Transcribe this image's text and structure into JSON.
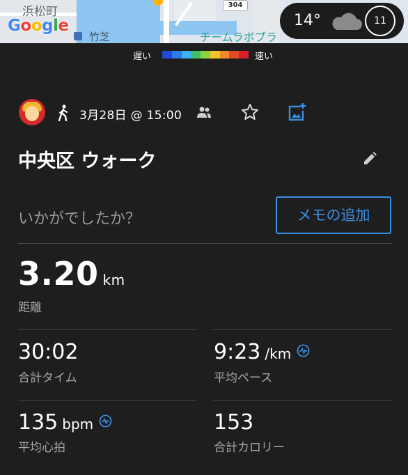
{
  "map": {
    "town_label": "浜松町",
    "station_label": "竹芝",
    "team_label": "チームラボプラ",
    "road_number": "304",
    "google_letters": [
      "G",
      "o",
      "o",
      "g",
      "l",
      "e"
    ]
  },
  "weather": {
    "temperature": "14°",
    "icon": "cloud-icon",
    "count": "11"
  },
  "speed_legend": {
    "slow_label": "遅い",
    "fast_label": "速い",
    "colors": [
      "#1f4bd6",
      "#2d7ae6",
      "#3fb0f0",
      "#3fbf6a",
      "#8fd13a",
      "#f2c12e",
      "#f08a2a",
      "#e24a2a",
      "#d81f2a"
    ]
  },
  "activity": {
    "type_icon": "walk-icon",
    "date": "3月28日 @ 15:00",
    "title": "中央区 ウォーク",
    "feeling_prompt": "いかがでしたか？",
    "add_memo_label": "メモの追加"
  },
  "stats": {
    "distance": {
      "value": "3.20",
      "unit": "km",
      "label": "距離"
    },
    "total_time": {
      "value": "30:02",
      "label": "合計タイム"
    },
    "avg_pace": {
      "value": "9:23",
      "unit": "/km",
      "label": "平均ペース"
    },
    "avg_heart_rate": {
      "value": "135",
      "unit": "bpm",
      "label": "平均心拍"
    },
    "calories": {
      "value": "153",
      "label": "合計カロリー"
    }
  },
  "colors": {
    "background": "#1e1e1e",
    "accent": "#3a8ee0",
    "muted_text": "#a6a6a6"
  }
}
